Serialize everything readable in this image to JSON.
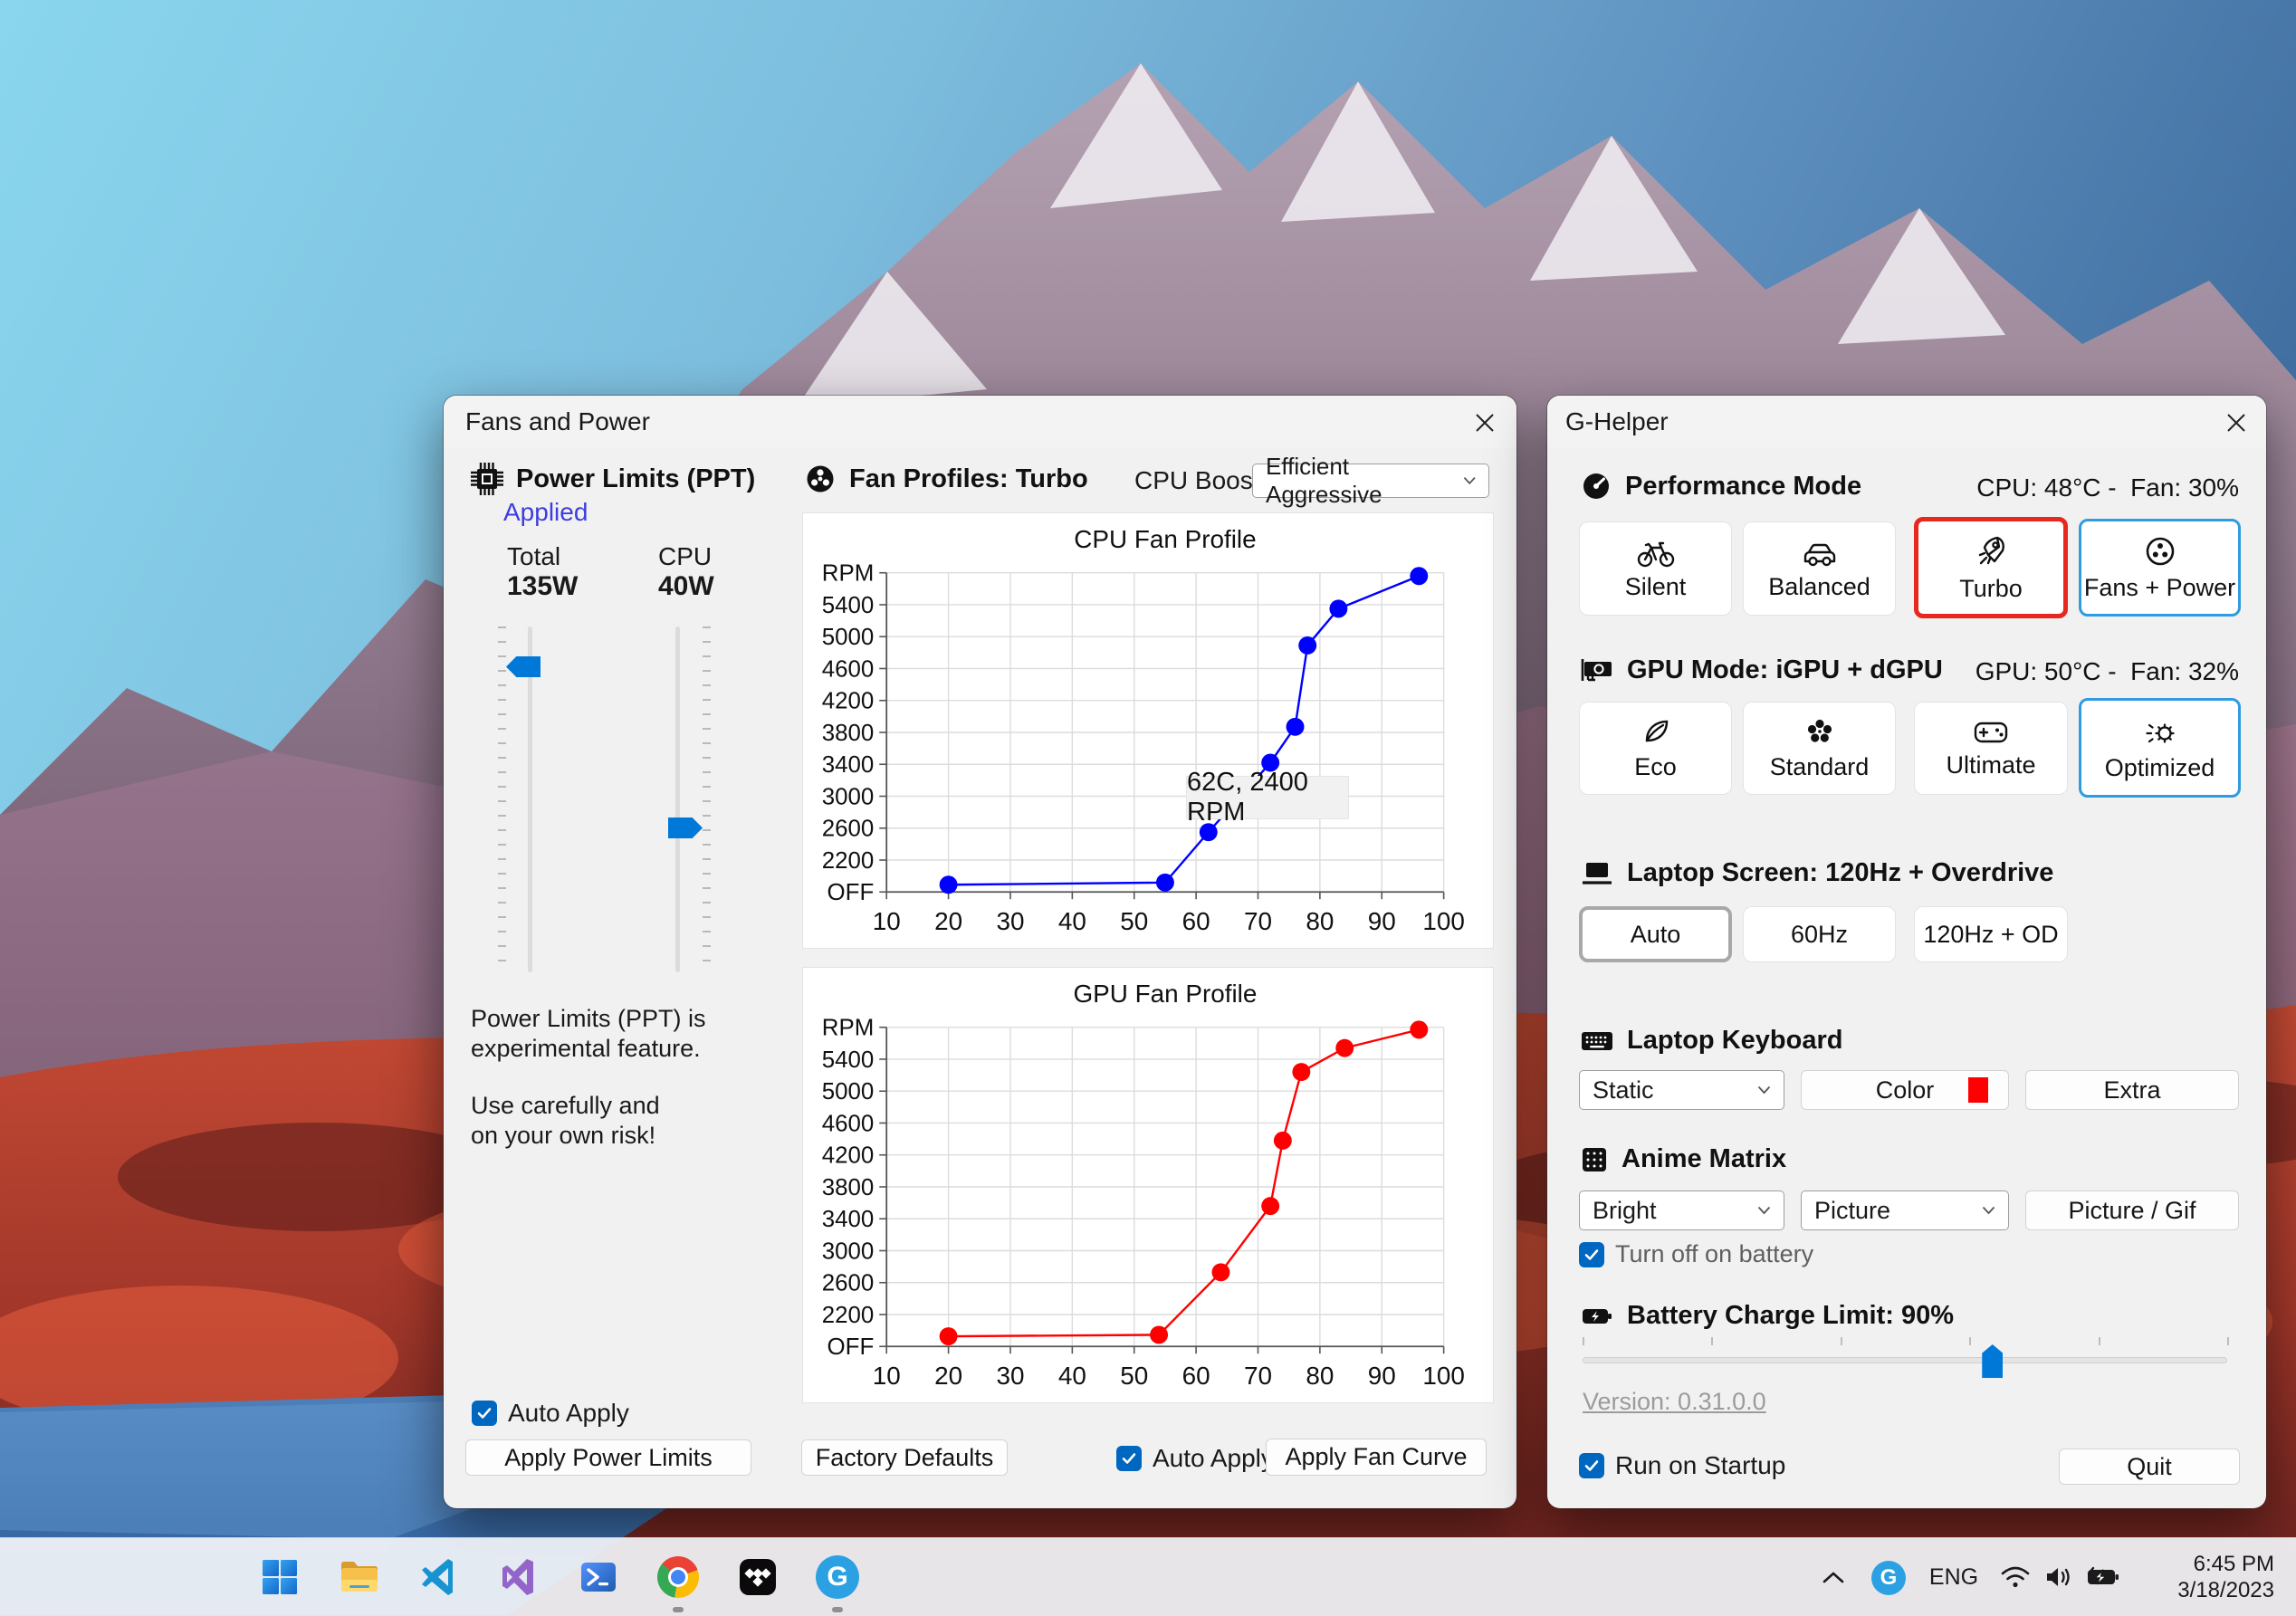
{
  "fans_window": {
    "title": "Fans and Power",
    "power": {
      "header": "Power Limits (PPT)",
      "status": "Applied",
      "total_label": "Total",
      "total_value": "135W",
      "cpu_label": "CPU",
      "cpu_value": "40W",
      "note1": "Power Limits (PPT) is",
      "note2": "experimental feature.",
      "note3": "Use carefully and",
      "note4": "on your own risk!",
      "auto_apply": "Auto Apply",
      "apply": "Apply Power Limits"
    },
    "profiles": {
      "header": "Fan Profiles: Turbo",
      "boost_label": "CPU Boost",
      "boost_value": "Efficient Aggressive",
      "factory": "Factory Defaults",
      "auto_apply": "Auto Apply",
      "apply": "Apply Fan Curve"
    }
  },
  "chart_data": [
    {
      "type": "line",
      "title": "CPU Fan Profile",
      "series_color": "#0000ff",
      "x": [
        20,
        55,
        62,
        72,
        76,
        78,
        83,
        96
      ],
      "y": [
        500,
        650,
        2550,
        3420,
        3870,
        4890,
        5350,
        5760
      ],
      "x_ticks": [
        10,
        20,
        30,
        40,
        50,
        60,
        70,
        80,
        90,
        100
      ],
      "y_tick_labels": [
        "OFF",
        "2200",
        "2600",
        "3000",
        "3400",
        "3800",
        "4200",
        "4600",
        "5000",
        "5400",
        "RPM"
      ],
      "grid": true,
      "tooltip_text": "62C, 2400 RPM"
    },
    {
      "type": "line",
      "title": "GPU Fan Profile",
      "series_color": "#ff0000",
      "x": [
        20,
        54,
        64,
        72,
        74,
        77,
        84,
        96
      ],
      "y": [
        700,
        800,
        2730,
        3560,
        4380,
        5240,
        5540,
        5770
      ],
      "x_ticks": [
        10,
        20,
        30,
        40,
        50,
        60,
        70,
        80,
        90,
        100
      ],
      "y_tick_labels": [
        "OFF",
        "2200",
        "2600",
        "3000",
        "3400",
        "3800",
        "4200",
        "4600",
        "5000",
        "5400",
        "RPM"
      ],
      "grid": true
    }
  ],
  "ghelper": {
    "title": "G-Helper",
    "performance": {
      "header": "Performance Mode",
      "status": "CPU: 48°C -  Fan: 30%",
      "modes": [
        {
          "label": "Silent",
          "icon": "bicycle-icon",
          "selected": false
        },
        {
          "label": "Balanced",
          "icon": "car-icon",
          "selected": false
        },
        {
          "label": "Turbo",
          "icon": "rocket-icon",
          "selected": true,
          "selected_color": "#e8281e"
        },
        {
          "label": "Fans + Power",
          "icon": "fan-icon",
          "selected": true,
          "selected_color": "#2f9be0"
        }
      ]
    },
    "gpu": {
      "header": "GPU Mode: iGPU + dGPU",
      "status": "GPU: 50°C -  Fan: 32%",
      "modes": [
        {
          "label": "Eco",
          "icon": "leaf-icon",
          "selected": false
        },
        {
          "label": "Standard",
          "icon": "flower-icon",
          "selected": false
        },
        {
          "label": "Ultimate",
          "icon": "gamepad-icon",
          "selected": false
        },
        {
          "label": "Optimized",
          "icon": "optimized-icon",
          "selected": true,
          "selected_color": "#2f9be0"
        }
      ]
    },
    "screen": {
      "header": "Laptop Screen: 120Hz + Overdrive",
      "options": [
        {
          "label": "Auto",
          "selected": true
        },
        {
          "label": "60Hz",
          "selected": false
        },
        {
          "label": "120Hz + OD",
          "selected": false
        }
      ]
    },
    "keyboard": {
      "header": "Laptop Keyboard",
      "mode_value": "Static",
      "color_label": "Color",
      "color_swatch": "#ff0000",
      "extra_label": "Extra"
    },
    "matrix": {
      "header": "Anime Matrix",
      "brightness_value": "Bright",
      "mode_value": "Picture",
      "picture_label": "Picture / Gif",
      "battery_checkbox": "Turn off on battery"
    },
    "battery": {
      "header": "Battery Charge Limit: 90%",
      "value": 90,
      "range_min": 50,
      "range_max": 100
    },
    "version": "Version: 0.31.0.0",
    "startup_label": "Run on Startup",
    "quit_label": "Quit"
  },
  "taskbar": {
    "pinned_icons": [
      "windows-start",
      "file-explorer",
      "vscode",
      "visual-studio",
      "powershell",
      "chrome",
      "tidal",
      "g-helper"
    ],
    "running_indicators": [
      "chrome",
      "g-helper"
    ],
    "tray": {
      "language": "ENG",
      "time": "6:45 PM",
      "date": "3/18/2023"
    }
  },
  "colors": {
    "accent_blue": "#0078d7",
    "checkbox_blue": "#0067c0",
    "selected_red": "#e8281e",
    "selected_blue": "#2f9be0",
    "applied_link": "#3d3de0"
  }
}
